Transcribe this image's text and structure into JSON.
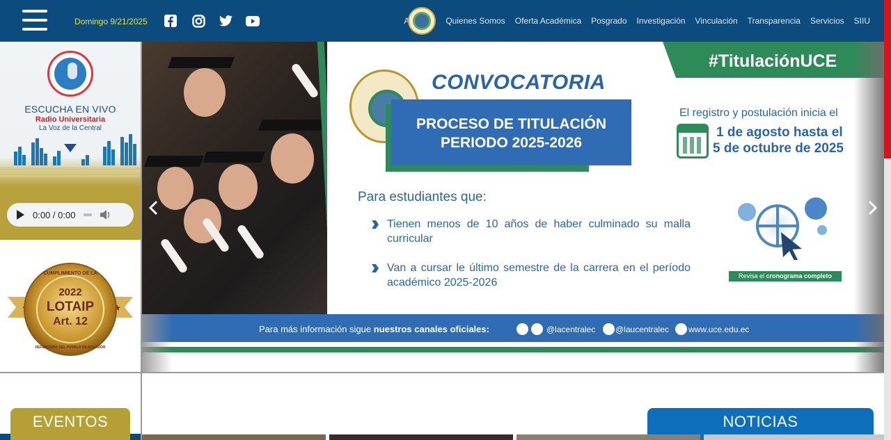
{
  "header": {
    "date": "Domingo 9/21/2025",
    "social": [
      {
        "icon": "facebook-icon"
      },
      {
        "icon": "instagram-icon"
      },
      {
        "icon": "twitter-icon"
      },
      {
        "icon": "youtube-icon"
      }
    ],
    "logo_letter": "A",
    "nav": [
      "Quienes Somos",
      "Oferta Académica",
      "Posgrado",
      "Investigación",
      "Vinculación",
      "Transparencia",
      "Servicios",
      "SIIU"
    ],
    "colors": {
      "bar": "#0b4b7e",
      "date": "#e4e24a"
    }
  },
  "radio": {
    "line1": "ESCUCHA EN VIVO",
    "line2": "Radio Universitaria",
    "line3": "La Voz de la Central",
    "player_time": "0:00 / 0:00"
  },
  "lotaip": {
    "ring_top": "CUMPLIMIENTO DE LA",
    "year": "2022",
    "name": "LOTAIP",
    "article": "Art. 12",
    "ring_bottom": "DEFENSORÍA DEL PUEBLO DE ECUADOR"
  },
  "slide": {
    "hashtag": "#TitulaciónUCE",
    "title": "CONVOCATORIA",
    "process_line1": "PROCESO DE TITULACIÓN",
    "process_line2": "PERIODO 2025-2026",
    "registration": "El registro y postulación inicia el",
    "date_line1": "1 de agosto hasta el",
    "date_line2": "5 de octubre de 2025",
    "for_students": "Para estudiantes que:",
    "bullets": [
      "Tienen menos de 10 años de haber culminado su malla curricular",
      "Van a cursar le último semestre de la carrera en el período académico 2025-2026"
    ],
    "revisa_prefix": "Revisa el",
    "revisa_bold": "cronograma completo",
    "info_prefix": "Para más información sigue",
    "info_bold": "nuestros canales oficiales:",
    "handle_x": "@lacentralec",
    "handle_ig": "@laucentralec",
    "website": "www.uce.edu.ec",
    "seal_text": "UNIVERSIDAD CENTRAL DEL ECUADOR",
    "seal_city": "QUITO"
  },
  "sections": {
    "eventos": "EVENTOS",
    "noticias": "NOTICIAS"
  },
  "colors": {
    "accent_green": "#2f8a5a",
    "accent_blue": "#2f6cb4",
    "gold": "#b4a035",
    "noticias_blue": "#0d6ebc",
    "scroll_thumb": "#d5141d"
  }
}
